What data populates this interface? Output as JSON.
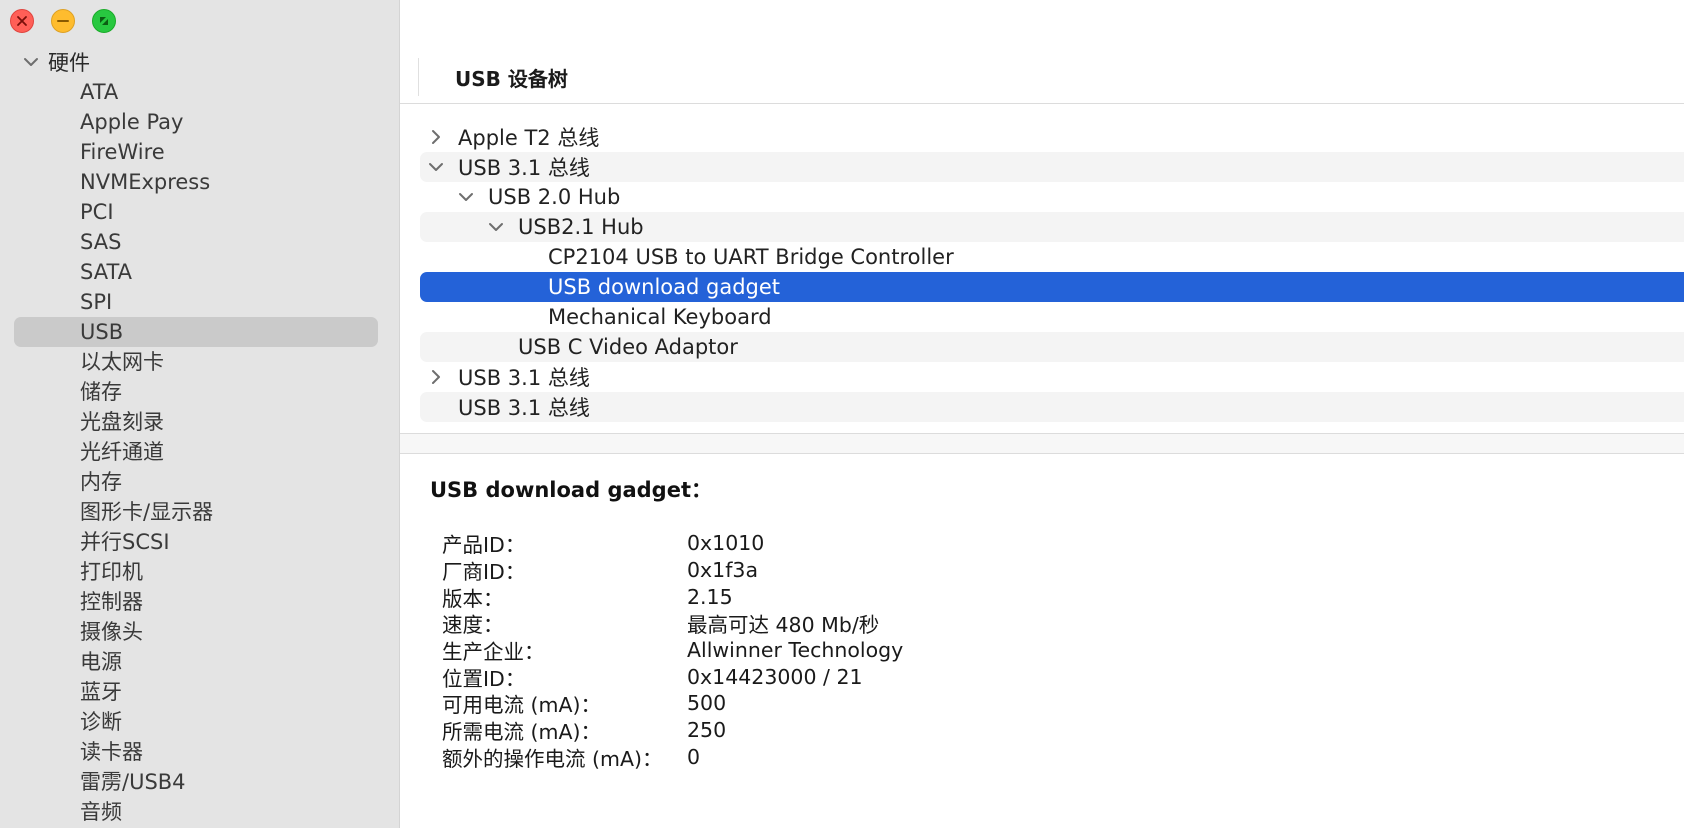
{
  "sidebar": {
    "header": "硬件",
    "items": [
      {
        "label": "ATA",
        "selected": false
      },
      {
        "label": "Apple Pay",
        "selected": false
      },
      {
        "label": "FireWire",
        "selected": false
      },
      {
        "label": "NVMExpress",
        "selected": false
      },
      {
        "label": "PCI",
        "selected": false
      },
      {
        "label": "SAS",
        "selected": false
      },
      {
        "label": "SATA",
        "selected": false
      },
      {
        "label": "SPI",
        "selected": false
      },
      {
        "label": "USB",
        "selected": true
      },
      {
        "label": "以太网卡",
        "selected": false
      },
      {
        "label": "储存",
        "selected": false
      },
      {
        "label": "光盘刻录",
        "selected": false
      },
      {
        "label": "光纤通道",
        "selected": false
      },
      {
        "label": "内存",
        "selected": false
      },
      {
        "label": "图形卡/显示器",
        "selected": false
      },
      {
        "label": "并行SCSI",
        "selected": false
      },
      {
        "label": "打印机",
        "selected": false
      },
      {
        "label": "控制器",
        "selected": false
      },
      {
        "label": "摄像头",
        "selected": false
      },
      {
        "label": "电源",
        "selected": false
      },
      {
        "label": "蓝牙",
        "selected": false
      },
      {
        "label": "诊断",
        "selected": false
      },
      {
        "label": "读卡器",
        "selected": false
      },
      {
        "label": "雷雳/USB4",
        "selected": false
      },
      {
        "label": "音频",
        "selected": false
      }
    ]
  },
  "tree": {
    "header": "USB 设备树",
    "rows": [
      {
        "label": "Apple T2 总线",
        "depth": 0,
        "disclosure": "collapsed",
        "selected": false
      },
      {
        "label": "USB 3.1 总线",
        "depth": 0,
        "disclosure": "expanded",
        "selected": false
      },
      {
        "label": "USB 2.0 Hub",
        "depth": 1,
        "disclosure": "expanded",
        "selected": false
      },
      {
        "label": "USB2.1 Hub",
        "depth": 2,
        "disclosure": "expanded",
        "selected": false
      },
      {
        "label": "CP2104 USB to UART Bridge Controller",
        "depth": 3,
        "disclosure": "none",
        "selected": false
      },
      {
        "label": "USB download gadget",
        "depth": 3,
        "disclosure": "none",
        "selected": true
      },
      {
        "label": "Mechanical Keyboard",
        "depth": 3,
        "disclosure": "none",
        "selected": false
      },
      {
        "label": "USB C Video Adaptor",
        "depth": 2,
        "disclosure": "none",
        "selected": false
      },
      {
        "label": "USB 3.1 总线",
        "depth": 0,
        "disclosure": "collapsed",
        "selected": false
      },
      {
        "label": "USB 3.1 总线",
        "depth": 0,
        "disclosure": "none",
        "selected": false
      }
    ]
  },
  "detail": {
    "title": "USB download gadget：",
    "fields": [
      {
        "key": "产品ID：",
        "value": "0x1010"
      },
      {
        "key": "厂商ID：",
        "value": "0x1f3a"
      },
      {
        "key": "版本：",
        "value": "2.15"
      },
      {
        "key": "速度：",
        "value": "最高可达 480 Mb/秒"
      },
      {
        "key": "生产企业：",
        "value": "Allwinner Technology"
      },
      {
        "key": "位置ID：",
        "value": "0x14423000 / 21"
      },
      {
        "key": "可用电流 (mA)：",
        "value": "500"
      },
      {
        "key": "所需电流 (mA)：",
        "value": "250"
      },
      {
        "key": "额外的操作电流 (mA)：",
        "value": "0"
      }
    ]
  },
  "colors": {
    "selection": "#2462d8",
    "sidebar_bg": "#e4e4e4",
    "sidebar_selected": "#cacaca"
  }
}
